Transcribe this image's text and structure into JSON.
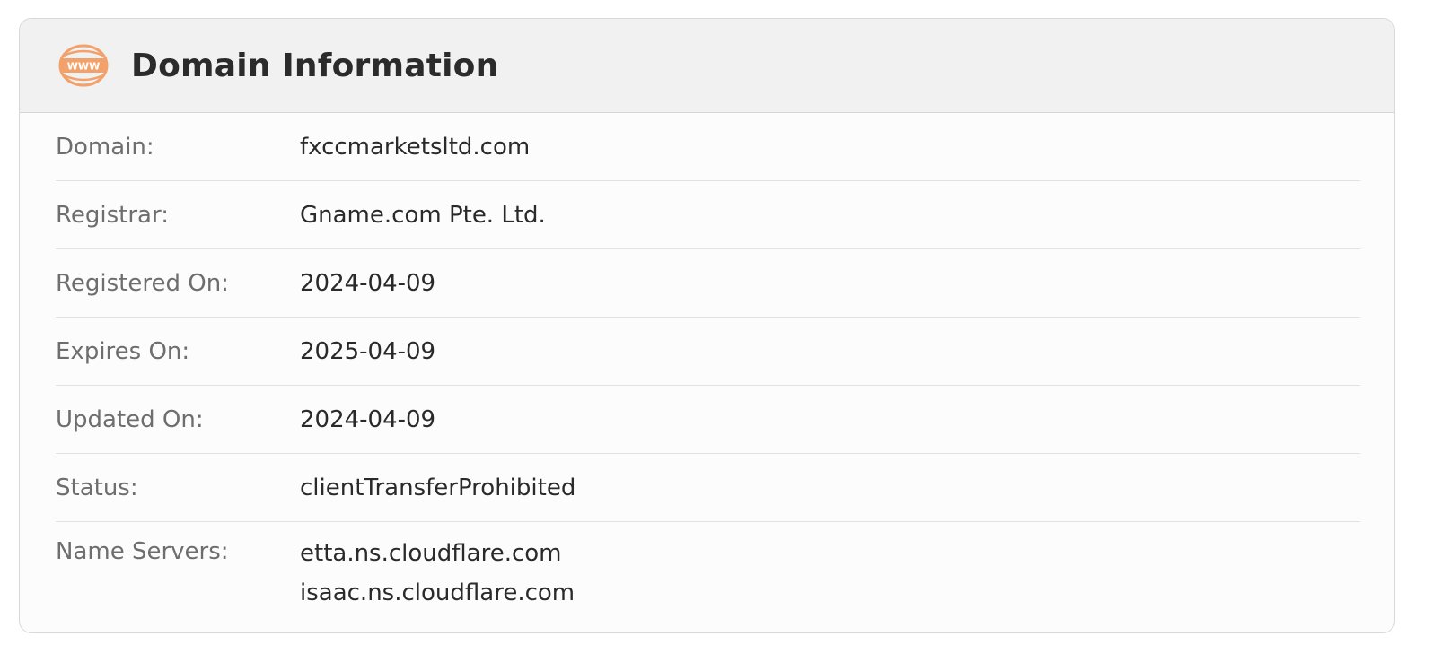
{
  "header": {
    "title": "Domain Information",
    "icon": "www-icon",
    "icon_color": "#f2a16b"
  },
  "rows": [
    {
      "label": "Domain:",
      "value": "fxccmarketsltd.com"
    },
    {
      "label": "Registrar:",
      "value": "Gname.com Pte. Ltd."
    },
    {
      "label": "Registered On:",
      "value": "2024-04-09"
    },
    {
      "label": "Expires On:",
      "value": "2025-04-09"
    },
    {
      "label": "Updated On:",
      "value": "2024-04-09"
    },
    {
      "label": "Status:",
      "value": "clientTransferProhibited"
    }
  ],
  "name_servers": {
    "label": "Name Servers:",
    "values": [
      "etta.ns.cloudflare.com",
      "isaac.ns.cloudflare.com"
    ]
  }
}
